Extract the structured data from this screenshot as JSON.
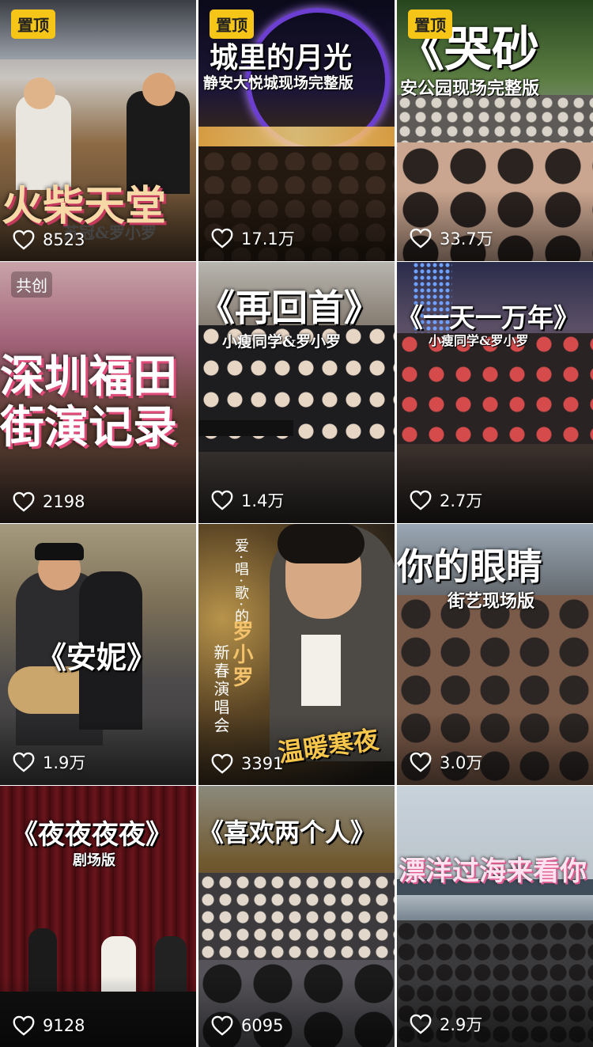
{
  "tiles": [
    {
      "badge": "置顶",
      "badge_type": "pin",
      "title": "火柴天堂",
      "subtitle": "苏冠&罗小罗",
      "likes": "8523"
    },
    {
      "badge": "置顶",
      "badge_type": "pin",
      "title": "城里的月光",
      "subtitle": "静安大悦城现场完整版",
      "likes": "17.1万"
    },
    {
      "badge": "置顶",
      "badge_type": "pin",
      "title": "《哭砂",
      "subtitle": "安公园现场完整版",
      "likes": "33.7万"
    },
    {
      "badge": "共创",
      "badge_type": "cocreate",
      "title_line1": "深圳福田",
      "title_line2": "街演记录",
      "likes": "2198"
    },
    {
      "title": "《再回首》",
      "subtitle": "小瘦同学&罗小罗",
      "likes": "1.4万"
    },
    {
      "title": "《一天一万年》",
      "subtitle": "小瘦同学&罗小罗",
      "likes": "2.7万"
    },
    {
      "title": "《安妮》",
      "likes": "1.9万"
    },
    {
      "vertical_text": "爱·唱·歌·的",
      "name": "罗小罗",
      "vertical_sub": "新春演唱会",
      "banner": "温暖寒夜",
      "likes": "3391"
    },
    {
      "title": "你的眼睛",
      "subtitle": "街艺现场版",
      "likes": "3.0万"
    },
    {
      "title": "《夜夜夜夜》",
      "subtitle": "剧场版",
      "likes": "9128"
    },
    {
      "title": "《喜欢两个人》",
      "likes": "6095"
    },
    {
      "title": "漂洋过海来看你",
      "likes": "2.9万"
    }
  ],
  "colors": {
    "pin": "#f5c518",
    "heart": "#ffffff"
  },
  "icons": {
    "like": "heart-outline-icon"
  }
}
